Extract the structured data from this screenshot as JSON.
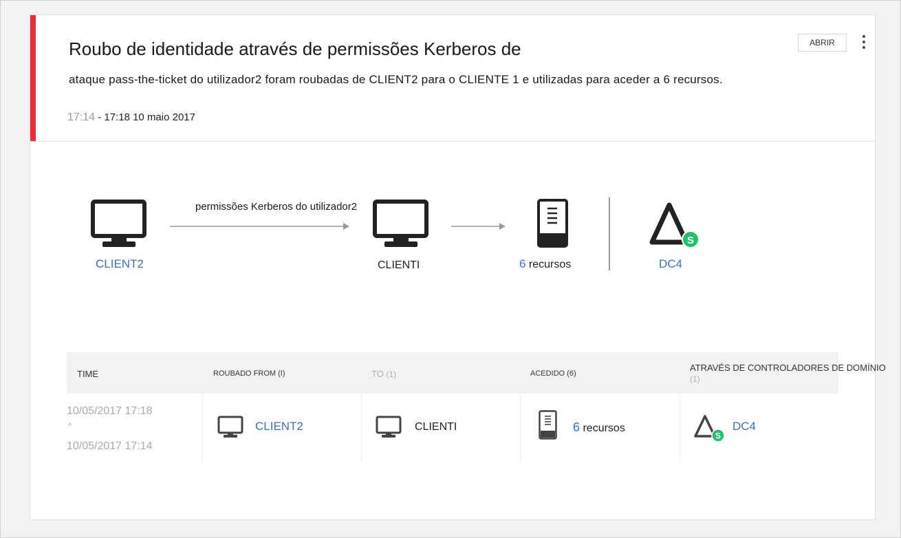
{
  "alert": {
    "title": "Roubo de identidade através de permissões Kerberos de",
    "description": "ataque pass-the-ticket do utilizador2 foram roubadas de CLIENT2 para o CLIENTE 1 e utilizadas para aceder a 6 recursos.",
    "time_start": "17:14",
    "time_end": "- 17:18 10 maio 2017",
    "open_label": "ABRIR",
    "accent_color": "#ee2b3a"
  },
  "diagram": {
    "source_label": "CLIENT2",
    "arrow_label": "permissões Kerberos do utilizador2",
    "target_label": "CLIENTI",
    "resources_count": "6",
    "resources_label": "recursos",
    "dc_label": "DC4",
    "dc_badge": "S"
  },
  "table": {
    "headers": {
      "time": "TIME",
      "stolen_from": "ROUBADO  FROM (I)",
      "to": "TO",
      "to_count": "(1)",
      "accessed": "ACEDIDO (6)",
      "via_dc": "ATRAVÉS DE CONTROLADORES DE DOMÍNIO",
      "via_dc_count": "(1)"
    },
    "row": {
      "time_end": "10/05/2017 17:18",
      "time_caret": "^",
      "time_start": "10/05/2017 17:14",
      "from": "CLIENT2",
      "to": "CLIENTI",
      "resources_count": "6",
      "resources_label": "recursos",
      "dc": "DC4",
      "dc_badge": "S"
    }
  }
}
